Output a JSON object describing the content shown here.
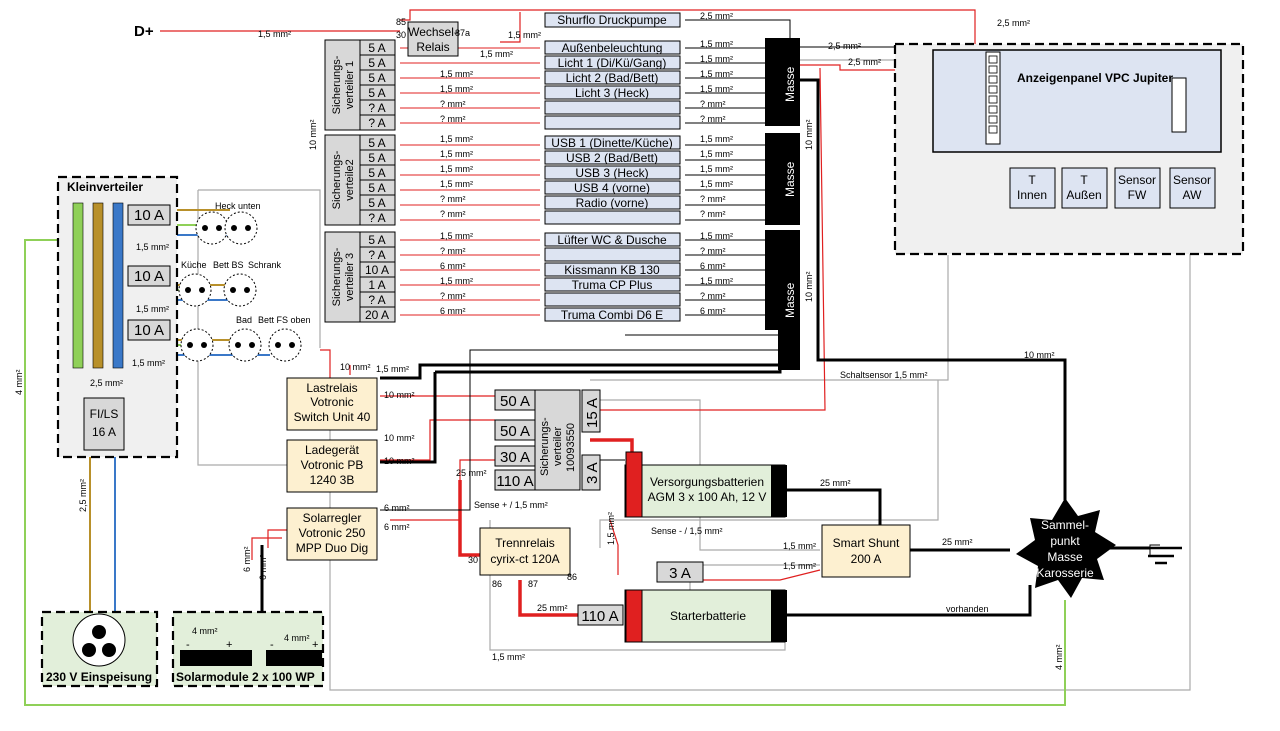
{
  "colors": {
    "red": "#e02020",
    "black": "#000000",
    "gray": "#aaaaaa",
    "green": "#8fd058",
    "yellow": "#b8902a",
    "blue": "#3a78c8",
    "panel_fill": "#dde4f2",
    "device_fill": "#fdf0d0",
    "battery_fill": "#e2efda",
    "fuse_fill": "#d8d8d8"
  },
  "icons": [
    "ground-icon",
    "outlet-icon",
    "solar-panel-icon",
    "battery-terminal-icon"
  ],
  "top": {
    "d_plus": "D+",
    "d_plus_wire": "1,5 mm²",
    "relay_title": [
      "Wechsel-",
      "Relais"
    ],
    "relay_pins": {
      "p85": "85",
      "p30": "30",
      "p87a": "87a"
    },
    "relay_out_wire": "1,5 mm²",
    "relay_in_wire": "1,5 mm²",
    "pump": "Shurflo Druckpumpe",
    "pump_wire": "2,5 mm²",
    "panel_feed_wire": "2,5 mm²"
  },
  "fuse_boxes": [
    {
      "label": [
        "Sicherungs-",
        "verteiler 1"
      ],
      "fuses": [
        "5 A",
        "5 A",
        "5 A",
        "5 A",
        "? A",
        "? A"
      ],
      "wires_in": [
        "",
        "",
        "1,5 mm²",
        "1,5 mm²",
        "? mm²",
        "? mm²"
      ],
      "loads": [
        "Außenbeleuchtung",
        "Licht 1 (Di/Kü/Gang)",
        "Licht 2 (Bad/Bett)",
        "Licht 3 (Heck)",
        "",
        ""
      ],
      "wires_out": [
        "1,5 mm²",
        "1,5 mm²",
        "1,5 mm²",
        "1,5 mm²",
        "? mm²",
        "? mm²"
      ]
    },
    {
      "label": [
        "Sicherungs-",
        "verteile2"
      ],
      "fuses": [
        "5 A",
        "5 A",
        "5 A",
        "5 A",
        "5 A",
        "? A"
      ],
      "wires_in": [
        "1,5 mm²",
        "1,5 mm²",
        "1,5 mm²",
        "1,5 mm²",
        "? mm²",
        "? mm²"
      ],
      "loads": [
        "USB 1 (Dinette/Küche)",
        "USB 2 (Bad/Bett)",
        "USB 3 (Heck)",
        "USB 4 (vorne)",
        "Radio (vorne)",
        ""
      ],
      "wires_out": [
        "1,5 mm²",
        "1,5 mm²",
        "1,5 mm²",
        "1,5 mm²",
        "? mm²",
        "? mm²"
      ]
    },
    {
      "label": [
        "Sicherungs-",
        "verteiler 3"
      ],
      "fuses": [
        "5 A",
        "? A",
        "10 A",
        "1 A",
        "? A",
        "20 A"
      ],
      "wires_in": [
        "1,5 mm²",
        "? mm²",
        "6 mm²",
        "1,5 mm²",
        "? mm²",
        "6 mm²"
      ],
      "loads": [
        "Lüfter WC & Dusche",
        "",
        "Kissmann  KB 130",
        "Truma CP Plus",
        "",
        "Truma Combi  D6 E"
      ],
      "wires_out": [
        "1,5 mm²",
        "? mm²",
        "6 mm²",
        "1,5 mm²",
        "? mm²",
        "6 mm²"
      ]
    }
  ],
  "fuse_feed_wire": "10 mm²",
  "masse": {
    "label": "Masse",
    "wire_top": "2,5 mm²",
    "wire_top2": "2,5 mm²",
    "wire_right": "10 mm²",
    "wire_right2": "10 mm²"
  },
  "panel": {
    "title": "Anzeigenpanel VPC Jupiter",
    "sensors": [
      {
        "label": [
          "T",
          "Innen"
        ]
      },
      {
        "label": [
          "T",
          "Außen"
        ]
      },
      {
        "label": [
          "Sensor",
          "FW"
        ]
      },
      {
        "label": [
          "Sensor",
          "AW"
        ]
      }
    ]
  },
  "kleinverteiler": {
    "title": "Kleinverteiler",
    "breakers": [
      "10 A",
      "10 A",
      "10 A"
    ],
    "fils": [
      "FI/LS",
      "16 A"
    ],
    "bus_wire": "2,5 mm²",
    "wire_labels": [
      "1,5 mm²",
      "1,5 mm²",
      "1,5 mm²"
    ],
    "outlet_labels": [
      "Heck unten",
      "Küche",
      "Bett BS",
      "Schrank",
      "Bad",
      "Bett FS oben"
    ],
    "feed_wire": "2,5 mm²",
    "pe_wire": "4 mm²"
  },
  "einspeisung": {
    "label": "230 V Einspeisung"
  },
  "solar_modules": {
    "label": "Solarmodule 2 x 100 WP",
    "wire1": "4 mm²",
    "wire2": "4 mm²",
    "minus": "-",
    "plus": "+"
  },
  "lastrelais": {
    "label": [
      "Lastrelais",
      "Votronic",
      "Switch Unit 40"
    ],
    "wire_top": "1,5 mm²",
    "wire_in": "10 mm²",
    "wire_out": "10 mm²"
  },
  "ladegeraet": {
    "label": [
      "Ladegerät",
      "Votronic PB",
      "1240 3B"
    ],
    "wire_a": "10 mm²",
    "wire_b": "10 mm²"
  },
  "solarregler": {
    "label": [
      "Solarregler",
      "Votronic 250",
      "MPP Duo Dig"
    ],
    "wire_a": "6 mm²",
    "wire_b": "6 mm²",
    "wire_c": "6 mm²",
    "wire_d": "6 mm²"
  },
  "main_fuses": {
    "label": [
      "Sicherungs-",
      "verteiler",
      "10093550"
    ],
    "left": [
      "50 A",
      "50 A",
      "30 A",
      "110 A"
    ],
    "right": [
      "15 A",
      "3 A"
    ],
    "wire_25": "25 mm²",
    "sense_plus": "Sense + / 1,5 mm²",
    "sense_minus": "Sense - / 1,5 mm²",
    "sense_wire": "1,5 mm²"
  },
  "versorgung": {
    "label": [
      "Versorgungsbatterien",
      "AGM 3 x 100 Ah, 12 V"
    ],
    "wire": "25 mm²"
  },
  "shunt": {
    "label": [
      "Smart Shunt",
      "200 A"
    ],
    "wire_a": "1,5 mm²",
    "wire_b": "1,5 mm²",
    "wire_c": "25 mm²"
  },
  "trennrelais": {
    "label": [
      "Trennrelais",
      "cyrix-ct 120A"
    ],
    "pins": [
      "30",
      "86",
      "87",
      "86"
    ],
    "wire": "25 mm²"
  },
  "starter": {
    "label": "Starterbatterie",
    "fuse_a": "3 A",
    "fuse_b": "110 A",
    "wire": "vorhanden",
    "bottom_wire": "1,5 mm²"
  },
  "sammelpunkt": {
    "label": [
      "Sammel-",
      "punkt",
      "Masse",
      "Karosserie"
    ],
    "wire_top": "10 mm²",
    "wire_pe": "4 mm²"
  },
  "schaltsensor": "Schaltsensor  1,5 mm²"
}
